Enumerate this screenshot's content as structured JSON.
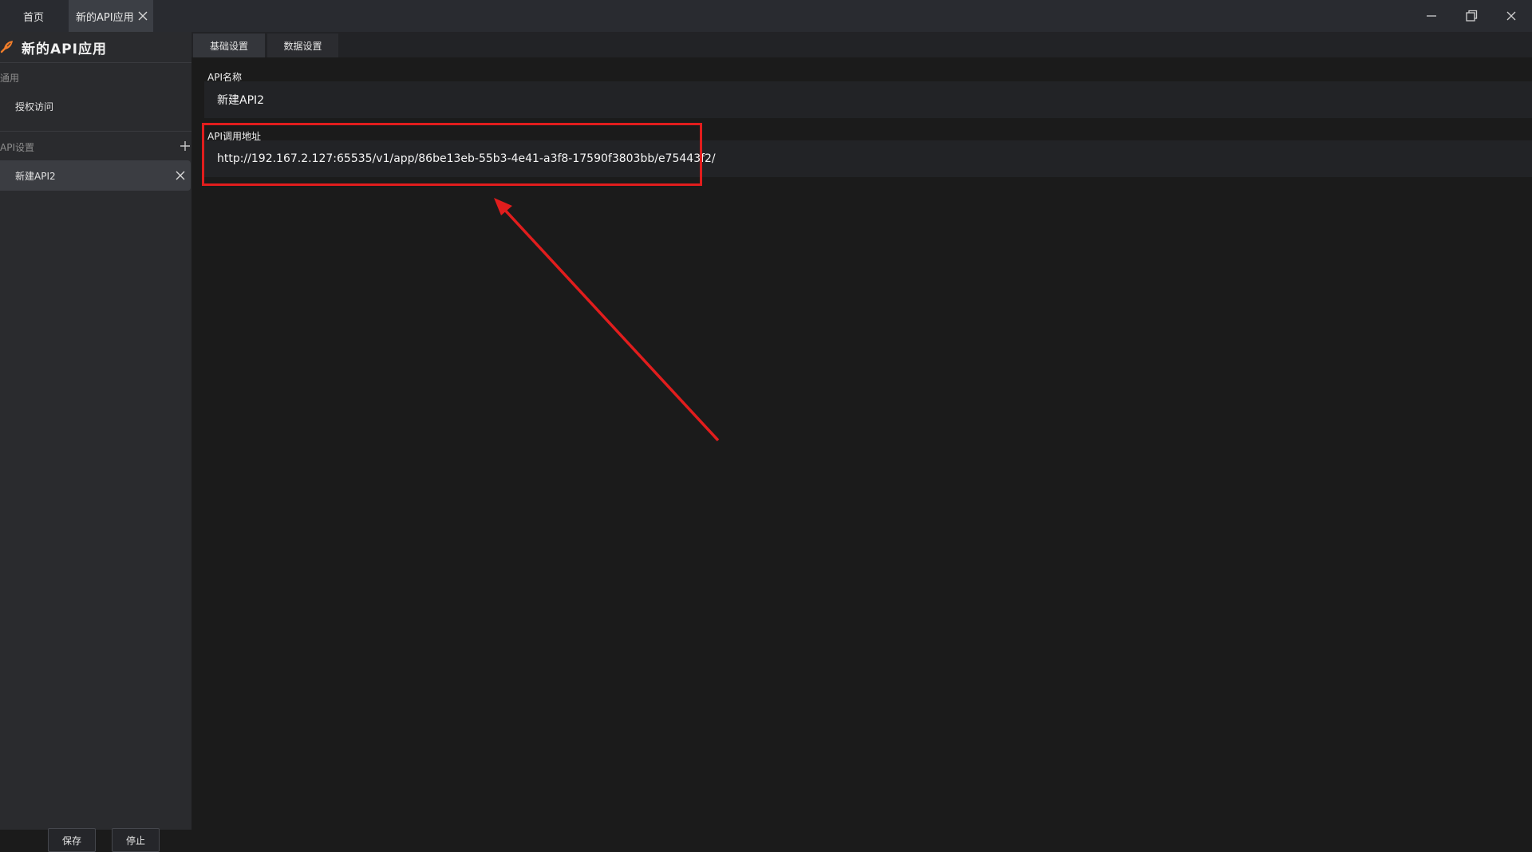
{
  "titlebar": {
    "tabs": [
      {
        "label": "首页"
      },
      {
        "label": "新的API应用"
      }
    ]
  },
  "sidebar": {
    "app_title": "新的API应用",
    "general_section": "通用",
    "general_items": [
      {
        "label": "授权访问"
      }
    ],
    "api_section": "API设置",
    "api_items": [
      {
        "label": "新建API2"
      }
    ],
    "save_label": "保存",
    "stop_label": "停止"
  },
  "main": {
    "tabs": [
      {
        "label": "基础设置"
      },
      {
        "label": "数据设置"
      }
    ],
    "api_name_label": "API名称",
    "api_name_value": "新建API2",
    "api_url_label": "API调用地址",
    "api_url_value": "http://192.167.2.127:65535/v1/app/86be13eb-55b3-4e41-a3f8-17590f3803bb/e75443f2/"
  },
  "colors": {
    "accent": "#f07d2a",
    "annotation": "#e11d1d",
    "background": "#1b1b1b",
    "sidebar": "#2a2b2e"
  },
  "icons": {
    "app_icon": "feather-brush-icon",
    "tab_close": "close-icon",
    "add": "plus-icon",
    "window_min": "minimize-icon",
    "window_restore": "restore-icon",
    "window_close": "close-icon"
  }
}
